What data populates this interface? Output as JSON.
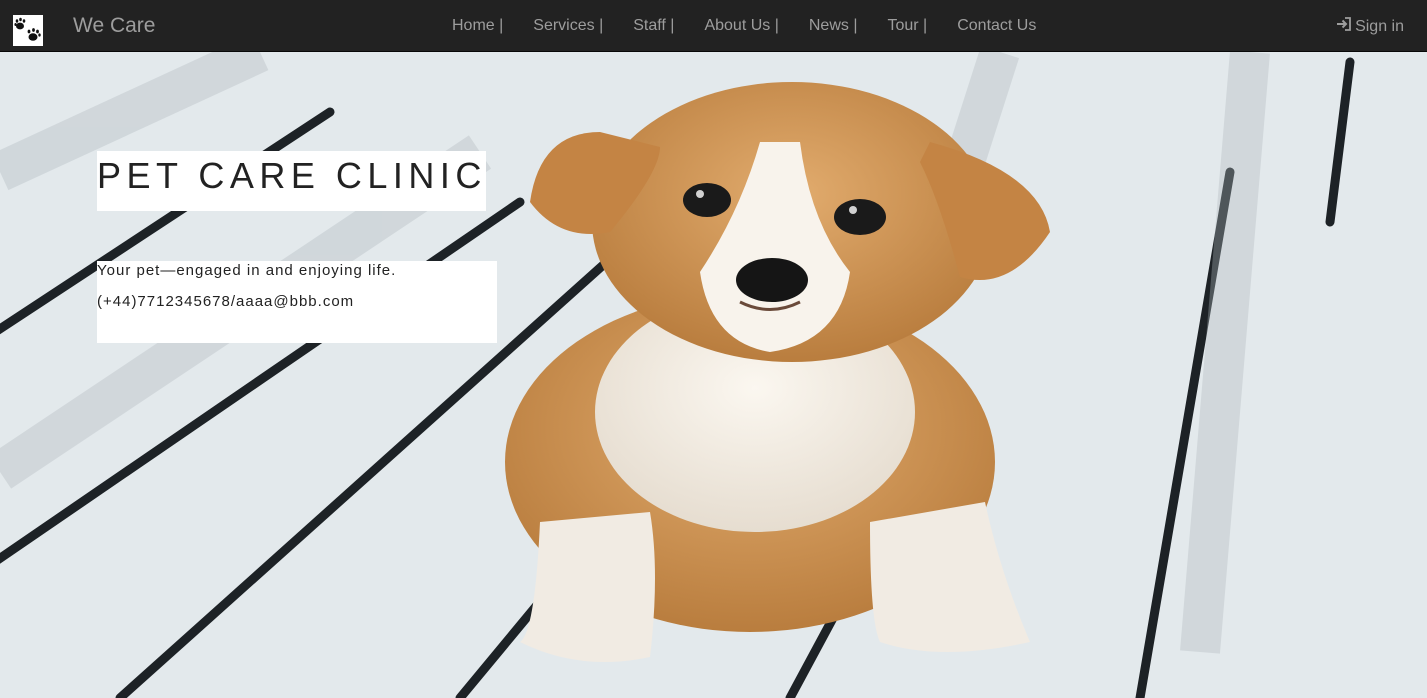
{
  "navbar": {
    "brand_name": "We Care",
    "logo_icon": "paw-icon",
    "links": [
      {
        "label": "Home |"
      },
      {
        "label": "Services |"
      },
      {
        "label": "Staff |"
      },
      {
        "label": "About Us |"
      },
      {
        "label": "News |"
      },
      {
        "label": "Tour |"
      },
      {
        "label": "Contact Us"
      }
    ],
    "signin_label": "Sign in",
    "signin_icon": "log-in-icon"
  },
  "hero": {
    "title": "PET CARE CLINIC",
    "tagline": "Your pet—engaged in and enjoying life.",
    "contact": "(+44)7712345678/aaaa@bbb.com",
    "image_subject": "puppy-photo"
  },
  "colors": {
    "navbar_bg": "#222222",
    "nav_text": "#9d9d9d",
    "text_box_bg": "#ffffff",
    "text": "#222222"
  }
}
